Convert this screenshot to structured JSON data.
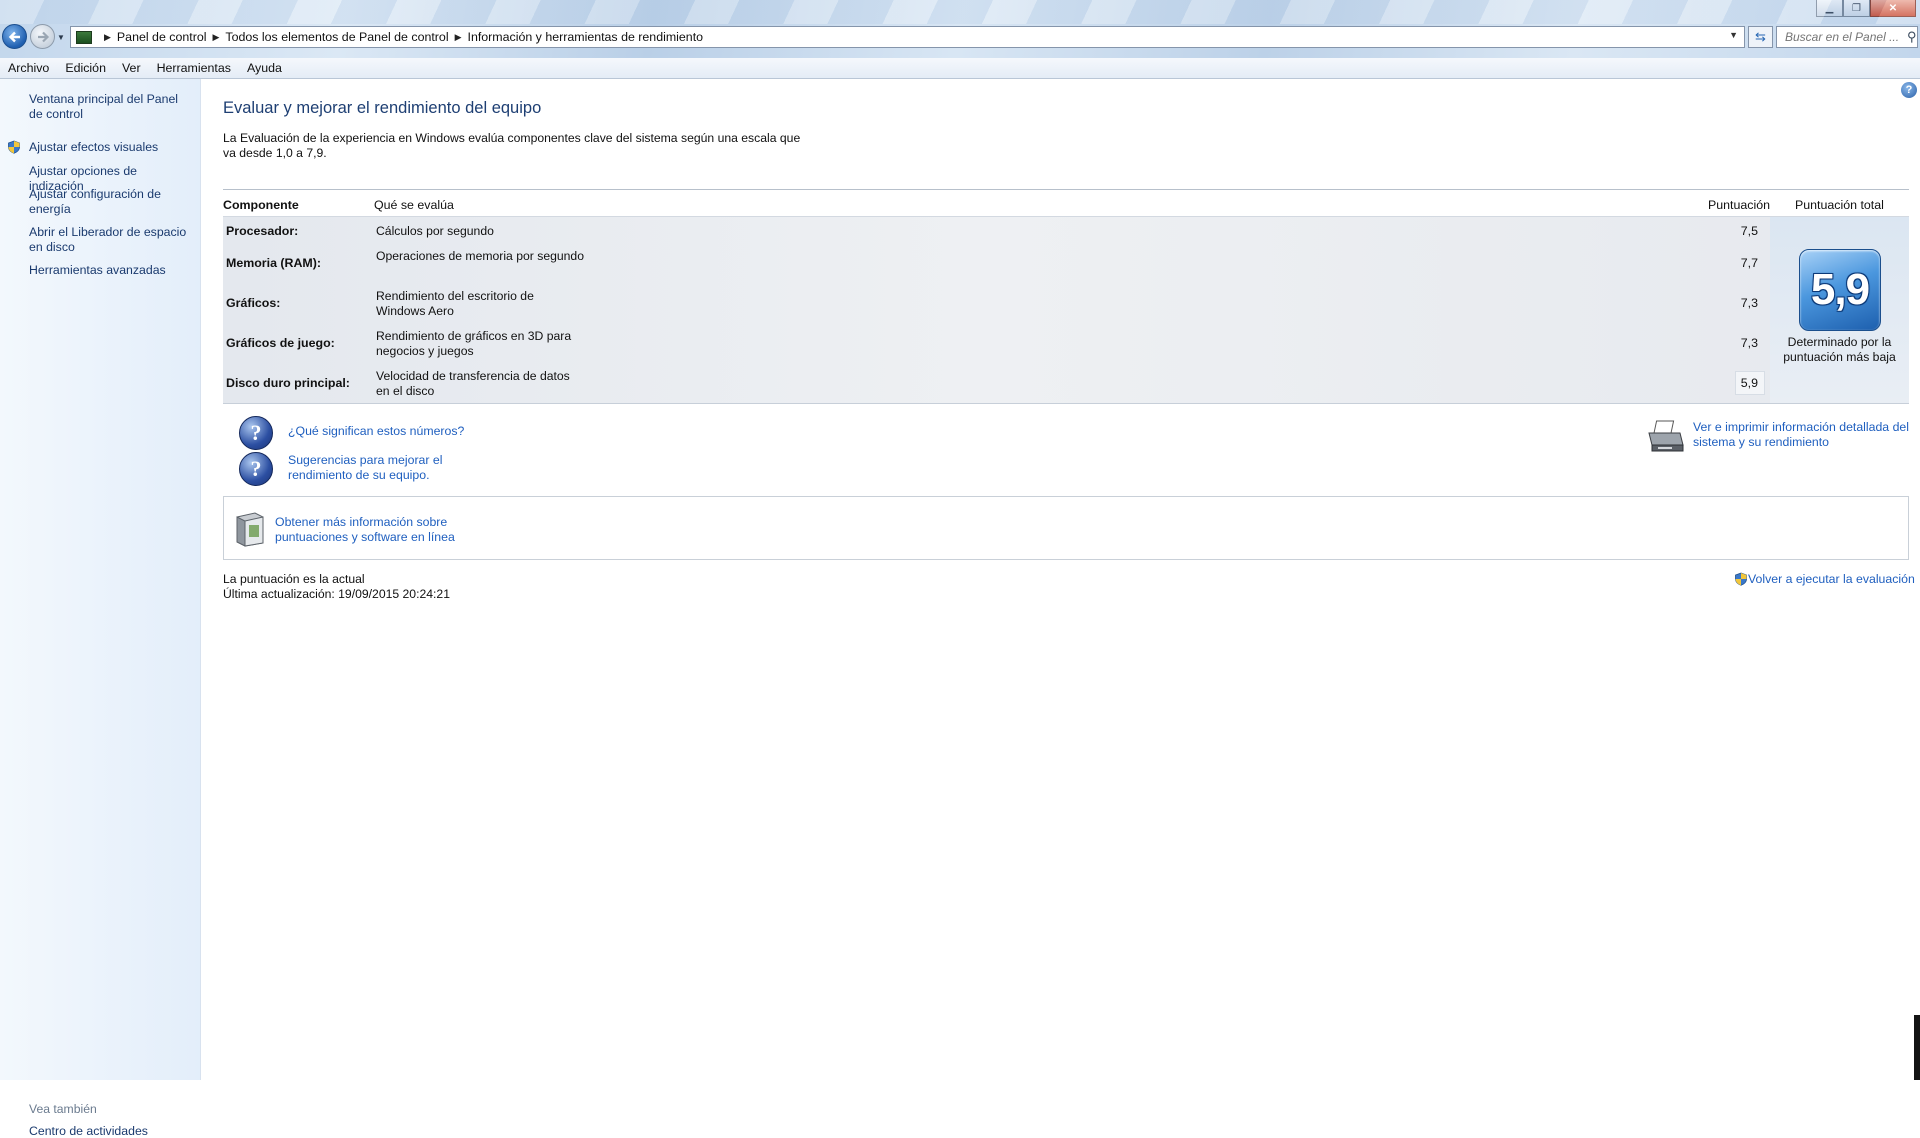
{
  "address": {
    "breadcrumbs": [
      "Panel de control",
      "Todos los elementos de Panel de control",
      "Información y herramientas de rendimiento"
    ],
    "search_placeholder": "Buscar en el Panel ..."
  },
  "menu": [
    "Archivo",
    "Edición",
    "Ver",
    "Herramientas",
    "Ayuda"
  ],
  "sidebar": {
    "home": "Ventana principal del Panel de control",
    "items": [
      {
        "label": "Ajustar efectos visuales",
        "icon": "shield-icon"
      },
      {
        "label": "Ajustar opciones de indización"
      },
      {
        "label": "Ajustar configuración de energía"
      },
      {
        "label": "Abrir el Liberador de espacio en disco"
      },
      {
        "label": "Herramientas avanzadas"
      }
    ],
    "see_also_title": "Vea también",
    "see_also_link": "Centro de actividades"
  },
  "main": {
    "title": "Evaluar y mejorar el rendimiento del equipo",
    "intro": "La Evaluación de la experiencia en Windows evalúa componentes clave del sistema según una escala que va desde 1,0 a 7,9.",
    "columns": {
      "component": "Componente",
      "what": "Qué se evalúa",
      "score": "Puntuación",
      "total": "Puntuación total"
    },
    "rows": [
      {
        "name": "Procesador:",
        "desc": "Cálculos por segundo",
        "score": "7,5"
      },
      {
        "name": "Memoria (RAM):",
        "desc": "Operaciones de memoria por segundo",
        "score": "7,7"
      },
      {
        "name": "Gráficos:",
        "desc": "Rendimiento del escritorio de Windows Aero",
        "score": "7,3"
      },
      {
        "name": "Gráficos de juego:",
        "desc": "Rendimiento de gráficos en 3D para negocios y juegos",
        "score": "7,3"
      },
      {
        "name": "Disco duro principal:",
        "desc": "Velocidad de transferencia de datos en el disco",
        "score": "5,9"
      }
    ],
    "total_score": "5,9",
    "total_note": "Determinado por la puntuación más baja",
    "links": {
      "numbers": "¿Qué significan estos números?",
      "tips": "Sugerencias para mejorar el rendimiento de su equipo.",
      "print": "Ver e imprimir información detallada del sistema y su rendimiento",
      "online": "Obtener más información sobre puntuaciones y software en línea",
      "rerun": "Volver a ejecutar la evaluación"
    },
    "status": "La puntuación es la actual",
    "last_update": "Última actualización: 19/09/2015 20:24:21"
  },
  "colors": {
    "link": "#1f5fbf",
    "title": "#1e3f73",
    "accent": "#2a60a8"
  }
}
